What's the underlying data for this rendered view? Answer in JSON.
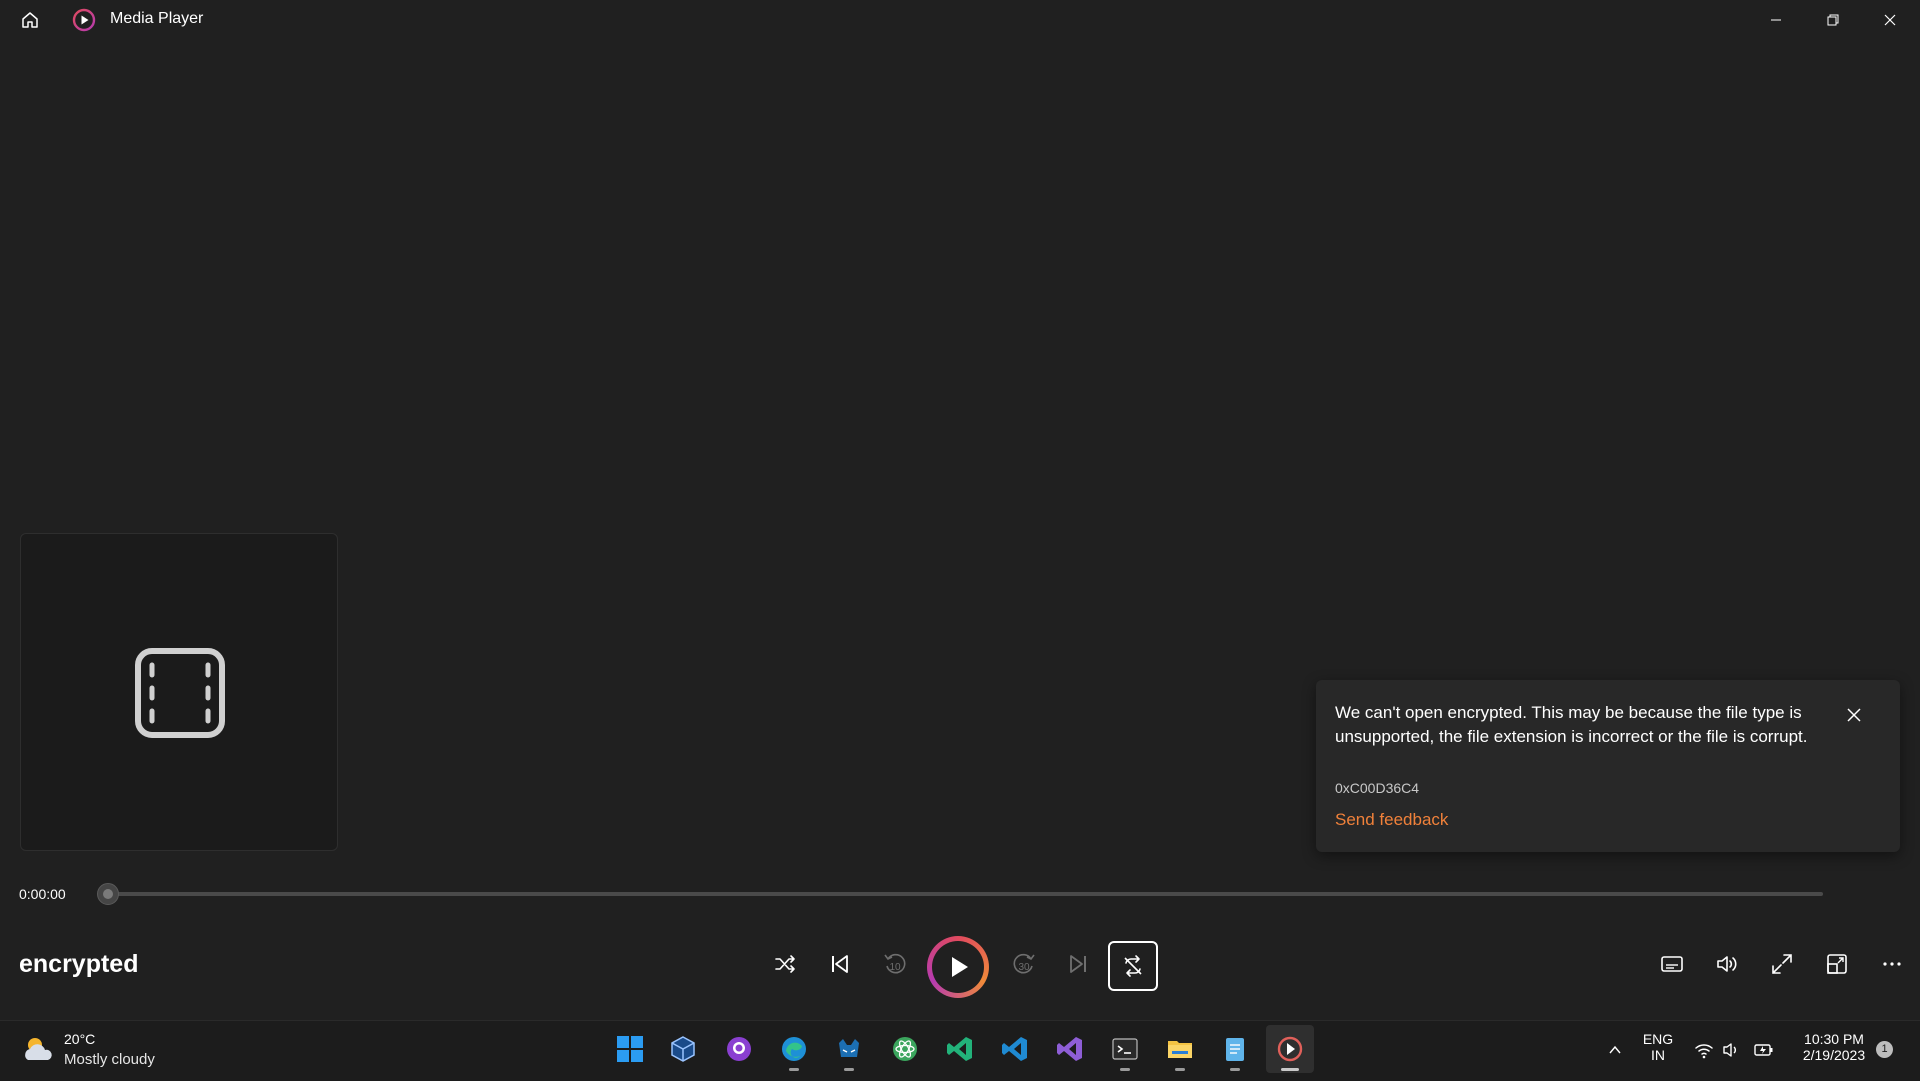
{
  "window": {
    "title": "Media Player"
  },
  "notification": {
    "message": "We can't open encrypted. This may be because the file type is unsupported, the file extension is incorrect or the file is corrupt.",
    "code": "0xC00D36C4",
    "link": "Send feedback"
  },
  "player": {
    "elapsed": "0:00:00",
    "progress": 0,
    "media_title": "encrypted",
    "seek_back_seconds": "10",
    "seek_forward_seconds": "30"
  },
  "taskbar": {
    "weather": {
      "temp": "20°C",
      "condition": "Mostly cloudy"
    },
    "apps": [
      {
        "name": "windows-start",
        "icon": "windows-logo"
      },
      {
        "name": "virtualbox",
        "icon": "cube-icon"
      },
      {
        "name": "github-desktop",
        "icon": "github-icon"
      },
      {
        "name": "edge",
        "icon": "edge-icon"
      },
      {
        "name": "terminal-alt",
        "icon": "cat-icon"
      },
      {
        "name": "atom",
        "icon": "atom-icon"
      },
      {
        "name": "visual-studio-code-green",
        "icon": "vscode-icon"
      },
      {
        "name": "visual-studio-code",
        "icon": "vscode-icon"
      },
      {
        "name": "visual-studio",
        "icon": "vs-icon"
      },
      {
        "name": "terminal",
        "icon": "terminal-icon"
      },
      {
        "name": "file-explorer",
        "icon": "folder-icon"
      },
      {
        "name": "notepad",
        "icon": "notepad-icon"
      },
      {
        "name": "media-player",
        "icon": "media-player-icon"
      }
    ],
    "language": {
      "line1": "ENG",
      "line2": "IN"
    },
    "clock": {
      "time": "10:30 PM",
      "date": "2/19/2023"
    },
    "notification_count": "1"
  },
  "colors": {
    "background": "#202020",
    "accent_link": "#f0813a",
    "play_gradient": [
      "#e04a5f",
      "#f08a3a",
      "#b63bb0"
    ]
  }
}
